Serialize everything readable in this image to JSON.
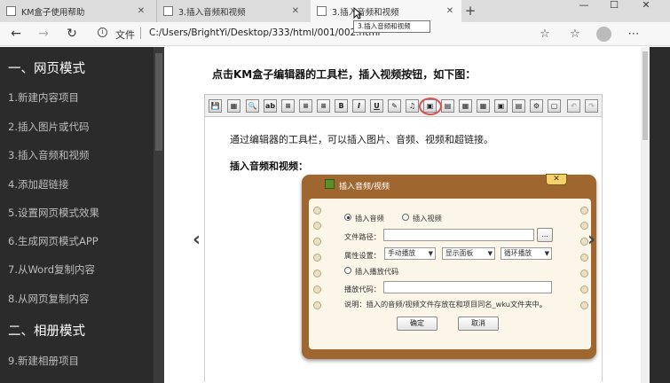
{
  "browser": {
    "tabs": [
      {
        "label": "KM盒子使用帮助",
        "close": "✕"
      },
      {
        "label": "3.插入音频和视频",
        "close": "✕"
      },
      {
        "label": "3.插入音频和视频",
        "close": "✕"
      }
    ],
    "new_tab": "+",
    "window_controls": [
      "—",
      "☐",
      "✕"
    ],
    "tooltip": "3.插入音频和视频",
    "nav": {
      "back": "←",
      "forward": "→",
      "refresh": "↻"
    },
    "address": {
      "info_icon": "i",
      "scheme_label": "文件",
      "url": "C:/Users/BrightYi/Desktop/333/html/001/002.html"
    },
    "toolbar_icons": {
      "favorite": "☆",
      "collections": "☆",
      "menu": "⋯"
    }
  },
  "sidebar": {
    "sections": [
      {
        "title": "一、网页模式",
        "items": [
          "1.新建内容项目",
          "2.插入图片或代码",
          "3.插入音频和视频",
          "4.添加超链接",
          "5.设置网页模式效果",
          "6.生成网页模式APP",
          "7.从Word复制内容",
          "8.从网页复制内容"
        ]
      },
      {
        "title": "二、相册模式",
        "items": [
          "9.新建相册项目"
        ]
      }
    ]
  },
  "content": {
    "heading": "点击KM盒子编辑器的工具栏，插入视频按钮，如下图：",
    "editor_toolbar": [
      "💾",
      "▦",
      "🔍",
      "ab",
      "≡",
      "≡",
      "≡",
      "B",
      "I",
      "U",
      "✎",
      "♫",
      "▣",
      "▤",
      "▦",
      "▦",
      "▣",
      "▤",
      "⚙",
      "▢",
      "↶",
      "↷"
    ],
    "paragraph": "通过编辑器的工具栏，可以插入图片、音频、视频和超链接。",
    "subheading": "插入音频和视频：",
    "nav_prev": "‹",
    "nav_next": "›",
    "dialog": {
      "title": "插入音频/视频",
      "close": "✕",
      "radio_audio": "插入音频",
      "radio_video": "插入视频",
      "file_path_label": "文件路径：",
      "browse": "...",
      "attr_label": "属性设置：",
      "select1": "手动播放",
      "select2": "显示面板",
      "select3": "循环播放",
      "radio_code": "插入播放代码",
      "code_label": "播放代码：",
      "note": "说明：插入的音频/视频文件存放在和项目同名_wku文件夹中。",
      "ok": "确定",
      "cancel": "取消"
    }
  }
}
